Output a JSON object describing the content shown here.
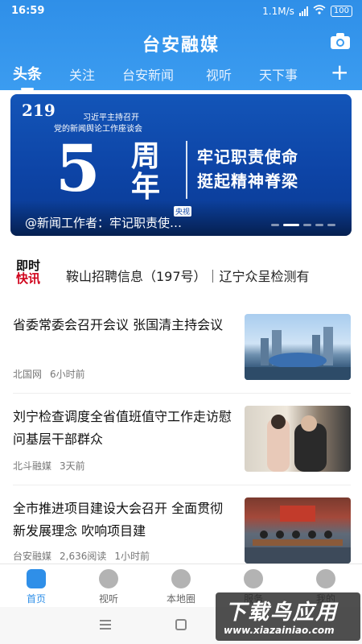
{
  "status_bar": {
    "time": "16:59",
    "network_speed": "1.1M/s",
    "battery": "100"
  },
  "header": {
    "logo": "台安融媒",
    "camera_icon": "camera-icon",
    "tabs": [
      "头条",
      "关注",
      "台安新闻",
      "视听",
      "天下事"
    ],
    "active_tab": "头条",
    "add_icon": "plus-icon"
  },
  "banner": {
    "badge_number": "219",
    "subtitle_line1": "习近平主持召开",
    "subtitle_line2": "党的新闻舆论工作座谈会",
    "big_number": "5",
    "anniversary": "周年",
    "slogan_line1": "牢记职责使命",
    "slogan_line2": "挺起精神脊梁",
    "source_tag": "央视",
    "caption": "@新闻工作者：牢记职责使…",
    "active_slide": 2,
    "slide_count": 5
  },
  "quick_news": {
    "logo_line1": "即时",
    "logo_line2": "快讯",
    "text": "鞍山招聘信息（197号）｜辽宁众呈检测有"
  },
  "news": [
    {
      "title": "省委常委会召开会议 张国清主持会议",
      "source": "北国网",
      "time": "6小时前",
      "reads": ""
    },
    {
      "title": "刘宁检查调度全省值班值守工作走访慰问基层干部群众",
      "source": "北斗融媒",
      "time": "3天前",
      "reads": ""
    },
    {
      "title": "全市推进项目建设大会召开 全面贯彻新发展理念 吹响项目建",
      "source": "台安融媒",
      "reads": "2,636阅读",
      "time": "1小时前"
    }
  ],
  "bottom_nav": [
    {
      "label": "首页",
      "icon": "home-icon"
    },
    {
      "label": "视听",
      "icon": "play-icon"
    },
    {
      "label": "本地圈",
      "icon": "compass-icon"
    },
    {
      "label": "服务",
      "icon": "handshake-icon"
    },
    {
      "label": "我的",
      "icon": "user-icon"
    }
  ],
  "active_nav": "首页",
  "watermark": {
    "main": "下载鸟应用",
    "url": "www.xiazainiao.com"
  },
  "colors": {
    "brand_blue": "#2f8fe8",
    "banner_blue": "#0d44a6"
  }
}
